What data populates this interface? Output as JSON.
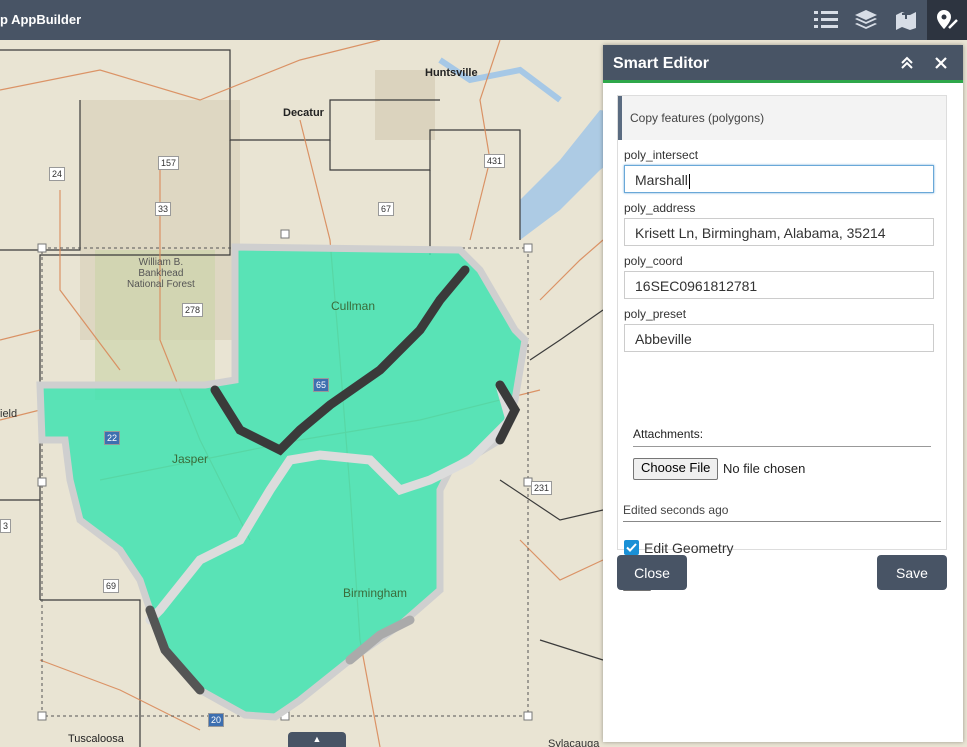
{
  "app": {
    "title": "p AppBuilder"
  },
  "toolbar": {
    "icons": [
      "legend-icon",
      "layers-icon",
      "basemap-icon",
      "smart-editor-icon"
    ]
  },
  "map_labels": {
    "huntsville": "Huntsville",
    "decatur": "Decatur",
    "cullman": "Cullman",
    "jasper": "Jasper",
    "birmingham": "Birmingham",
    "tuscaloosa": "Tuscaloosa",
    "sylacauga": "Sylacauga",
    "forest": "William B.\nBankhead\nNational Forest",
    "field": "ield",
    "r157": "157",
    "r24": "24",
    "r33": "33",
    "r67": "67",
    "r278": "278",
    "r65": "65",
    "r22": "22",
    "r231": "231",
    "r69": "69",
    "r431": "431",
    "r20": "20",
    "r3": "3"
  },
  "panel": {
    "title": "Smart Editor",
    "template": "Copy features (polygons)",
    "fields": [
      {
        "label": "poly_intersect",
        "value": "Marshall"
      },
      {
        "label": "poly_address",
        "value": "Krisett Ln, Birmingham, Alabama, 35214"
      },
      {
        "label": "poly_coord",
        "value": "16SEC0961812781"
      },
      {
        "label": "poly_preset",
        "value": "Abbeville"
      }
    ],
    "attachments_label": "Attachments:",
    "choose_file": "Choose File",
    "no_file": "No file chosen",
    "edited": "Edited seconds ago",
    "edit_geometry": "Edit Geometry",
    "close_label": "Close",
    "save_label": "Save"
  },
  "colors": {
    "header": "#485465",
    "accent": "#2ea74a",
    "polygon": "#3fe3b0",
    "checkbox": "#1a90d6"
  }
}
